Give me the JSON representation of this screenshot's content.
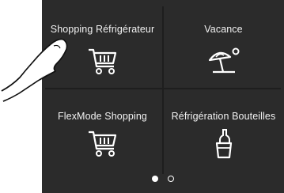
{
  "tiles": [
    {
      "label": "Shopping Réfrigérateur",
      "icon": "shopping-cart-icon"
    },
    {
      "label": "Vacance",
      "icon": "beach-umbrella-sun-icon"
    },
    {
      "label": "FlexMode Shopping",
      "icon": "shopping-cart-icon"
    },
    {
      "label": "Réfrigération Bouteilles",
      "icon": "bottle-cooler-icon"
    }
  ],
  "pagination": {
    "pages": 2,
    "current": 1
  },
  "colors": {
    "panel": "#2b2b2b",
    "text": "#ffffff",
    "divider": "#1e1e1e"
  }
}
